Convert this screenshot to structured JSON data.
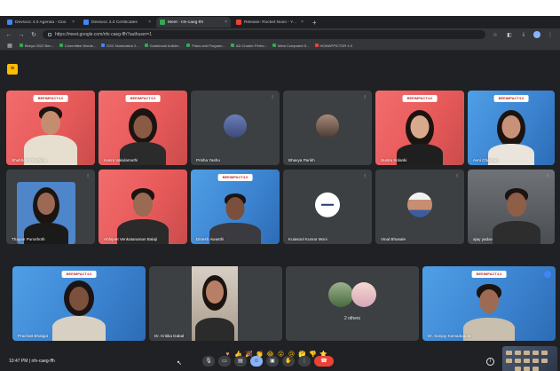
{
  "browser": {
    "tabs": [
      {
        "title": "Devsocc 4.0 Agenda - Goo",
        "favicon_color": "#4285f4",
        "active": false
      },
      {
        "title": "Devsocc 4.0 Certificates",
        "favicon_color": "#4285f4",
        "active": false
      },
      {
        "title": "Meet - nfv-caeg-ffh",
        "favicon_color": "#34a853",
        "active": true
      },
      {
        "title": "Release: Rocket Noon - YouT",
        "favicon_color": "#ea4335",
        "active": false
      }
    ],
    "new_tab_label": "+",
    "url": "https://meet.google.com/nfv-caeg-ffh?authuser=1",
    "bookmarks": [
      {
        "label": "Beeya 2022 Ben...",
        "color": "green"
      },
      {
        "label": "Committee Words...",
        "color": "green"
      },
      {
        "label": "DSC Nomination 2...",
        "color": "green"
      },
      {
        "label": "Guidebook builder...",
        "color": "green"
      },
      {
        "label": "Plans and Program...",
        "color": "green"
      },
      {
        "label": "AD Charter Perfor...",
        "color": "green"
      },
      {
        "label": "Meta Computed S...",
        "color": "green"
      },
      {
        "label": "HOMAPPICTOR 4.0",
        "color": "green"
      }
    ]
  },
  "meet": {
    "app_badge": "≡",
    "banner_text": "BEEIMPACT4.0",
    "participants_row1": [
      {
        "name": "Shubham Rauthela",
        "bg": "red"
      },
      {
        "name": "Harini Vakulamuthi",
        "bg": "red"
      },
      {
        "name": "Prisha Yashu",
        "bg": "gray"
      },
      {
        "name": "Bhavya Parikh",
        "bg": "gray"
      },
      {
        "name": "Sunita Solanki",
        "bg": "red"
      },
      {
        "name": "Avni Chauhan",
        "bg": "blue"
      }
    ],
    "participants_row2": [
      {
        "name": "Thayan Purushoth",
        "bg": "gray"
      },
      {
        "name": "Abhijeet Venkataraman Balaji",
        "bg": "red"
      },
      {
        "name": "Dinesh Awasthi",
        "bg": "blue"
      },
      {
        "name": "Kulasool Kumar Moni",
        "bg": "gray"
      },
      {
        "name": "Vinal Bhasale",
        "bg": "gray"
      },
      {
        "name": "ajay yadav",
        "bg": "gray"
      }
    ],
    "participants_row3": [
      {
        "name": "Prachatt Bhalgat",
        "bg": "blue"
      },
      {
        "name": "Dr. Kritika Dabal",
        "bg": "gray"
      },
      {
        "name": "2 others",
        "bg": "gray"
      },
      {
        "name": "Dr. Sanjay Kamadugula",
        "bg": "blue"
      }
    ],
    "clock": "10:47 PM",
    "meeting_code": "nfv-caeg-ffh",
    "reactions": [
      "♥",
      "👍",
      "🎉",
      "👏",
      "😂",
      "😮",
      "😢",
      "🤔",
      "👎",
      "⭐"
    ]
  }
}
